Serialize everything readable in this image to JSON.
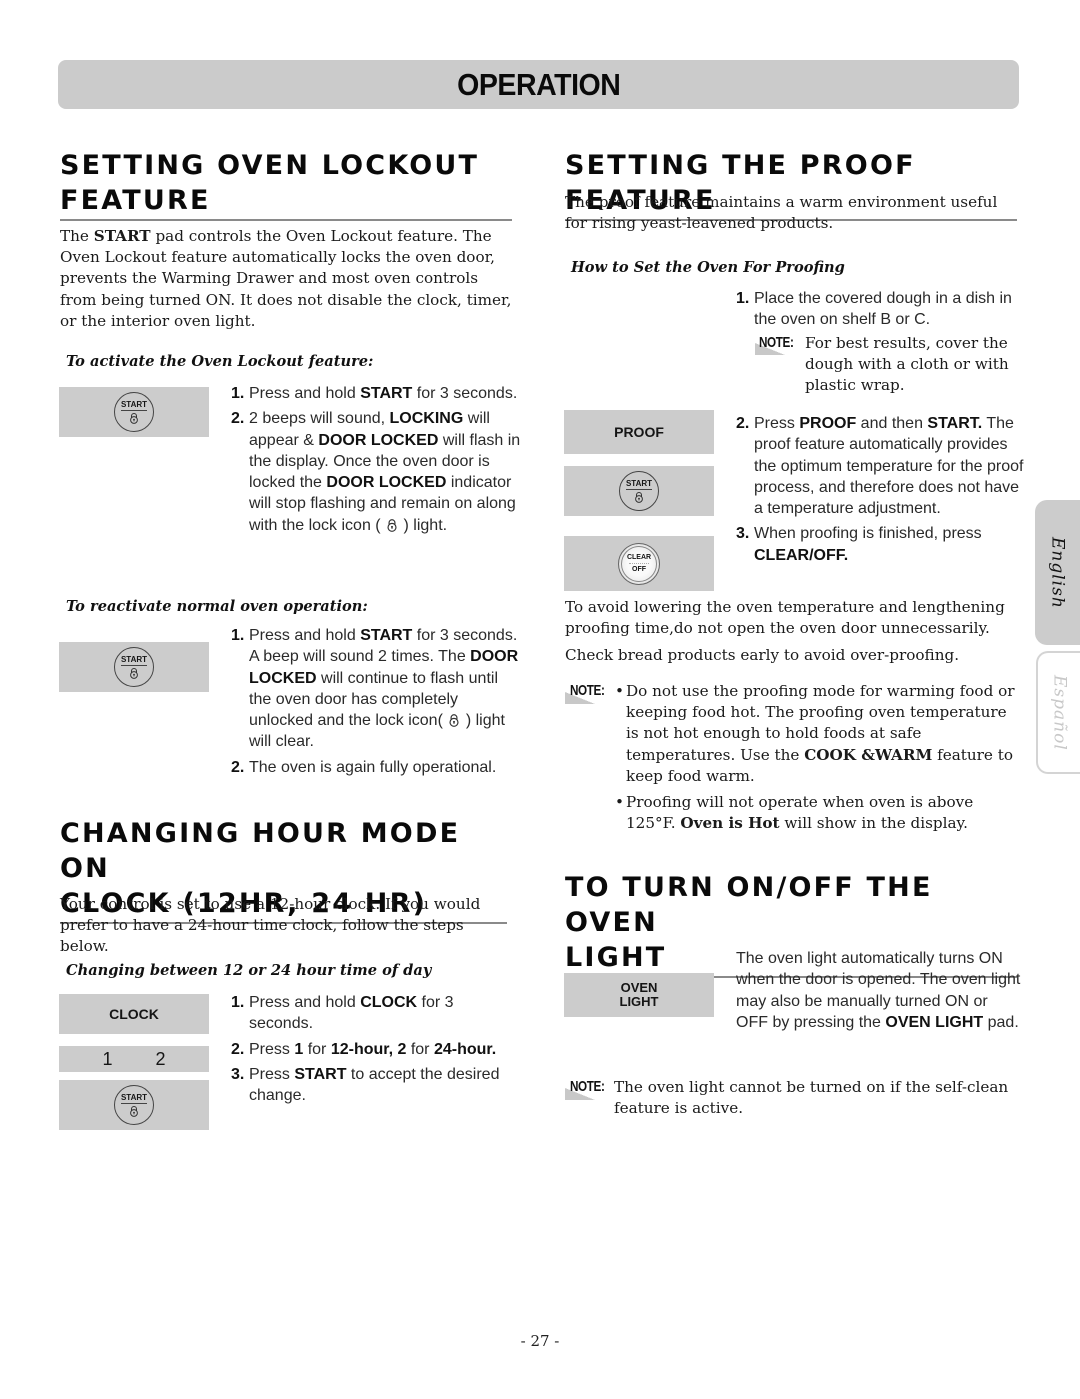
{
  "header": {
    "title": "OPERATION"
  },
  "lockout": {
    "title_line1": "SETTING OVEN LOCKOUT",
    "title_line2": "FEATURE",
    "intro_pre": "The ",
    "intro_bold": "START",
    "intro_post": " pad controls the Oven Lockout feature. The Oven Lockout feature automatically locks the oven door, prevents the Warming Drawer and most oven controls from being turned ON. It does not disable the clock, timer, or the interior oven light.",
    "activate_heading": "To activate the Oven Lockout feature:",
    "activate_pad": "START",
    "activate_steps": [
      {
        "num": "1.",
        "a": "Press and hold ",
        "b": "START",
        "c": " for 3 seconds."
      },
      {
        "num": "2.",
        "a": "2 beeps will sound, ",
        "b": "LOCKING",
        "c": " will appear & ",
        "d": "DOOR LOCKED",
        "e": " will flash in the display. Once the oven door is locked the ",
        "f": "DOOR LOCKED",
        "g": " indicator will stop flashing and remain on along with the lock icon (",
        "h": ") light."
      }
    ],
    "reactivate_heading": "To reactivate normal oven operation:",
    "reactivate_pad": "START",
    "reactivate_steps": [
      {
        "num": "1.",
        "a": "Press and hold ",
        "b": "START",
        "c": " for 3 seconds. A beep will sound 2 times. The ",
        "d": "DOOR LOCKED",
        "e": " will continue to flash until the oven door has completely unlocked and the lock icon(",
        "f": ") light will clear."
      },
      {
        "num": "2.",
        "a": "The oven is again fully operational."
      }
    ]
  },
  "hour_mode": {
    "title_line1": "CHANGING HOUR MODE ON",
    "title_line2": "CLOCK (12HR, 24 HR)",
    "intro": "Your control is set to use a 12-hour clock. If you would prefer to have a 24-hour time clock, follow the steps below.",
    "sub_heading": "Changing between 12 or 24 hour time of day",
    "pads": {
      "clock": "CLOCK",
      "key1": "1",
      "key2": "2",
      "start": "START"
    },
    "steps": [
      {
        "num": "1.",
        "a": "Press and hold ",
        "b": "CLOCK",
        "c": " for 3 seconds."
      },
      {
        "num": "2.",
        "a": "Press ",
        "b": "1",
        "c": " for ",
        "d": "12-hour, 2",
        "e": " for ",
        "f": "24-hour."
      },
      {
        "num": "3.",
        "a": "Press ",
        "b": "START",
        "c": " to accept the desired change."
      }
    ]
  },
  "proof": {
    "title": "SETTING THE PROOF FEATURE",
    "intro": "The proof feature maintains a warm environment useful for rising yeast-leavened products.",
    "sub_heading": "How to Set the Oven For Proofing",
    "step1": {
      "num": "1.",
      "text": "Place the covered dough in a dish in the oven on shelf B or C."
    },
    "note_label": "NOTE:",
    "step1_note": "For best results, cover the dough with a cloth or with plastic wrap.",
    "pads": {
      "proof": "PROOF",
      "start": "START",
      "clear_top": "CLEAR",
      "clear_bottom": "OFF"
    },
    "step2": {
      "num": "2.",
      "a": "Press ",
      "b": "PROOF",
      "c": " and then ",
      "d": "START.",
      "e": " The proof feature automatically provides the optimum temperature for the proof process, and therefore does not have a temperature adjustment."
    },
    "step3": {
      "num": "3.",
      "a": "When proofing is finished, press ",
      "b": "CLEAR/OFF."
    },
    "para1": "To avoid lowering the oven temperature and lengthening proofing time,do not open the oven door unnecessarily.",
    "para2": "Check bread products early to avoid over-proofing.",
    "notes": [
      {
        "a": "Do not use the proofing mode for warming food or keeping food hot. The proofing oven temperature is not hot enough to hold foods at safe temperatures. Use the ",
        "b": "COOK &WARM",
        "c": " feature to keep food warm."
      },
      {
        "a": "Proofing will not operate when oven is above 125°F. ",
        "b": "Oven is Hot",
        "c": " will show in the display."
      }
    ]
  },
  "oven_light": {
    "title_line1": "TO TURN ON/OFF THE OVEN",
    "title_line2": "LIGHT",
    "pad_line1": "OVEN",
    "pad_line2": "LIGHT",
    "text_a": "The oven light automatically turns ON when the door is opened. The oven light may also be manually turned ON or OFF by pressing the ",
    "text_b": "OVEN LIGHT",
    "text_c": " pad.",
    "note_label": "NOTE:",
    "note": "The oven light cannot be turned on if the self-clean feature is active."
  },
  "language_tabs": [
    {
      "label": "English",
      "active": true
    },
    {
      "label": "Español",
      "active": false
    }
  ],
  "footer": {
    "page_number": "- 27 -"
  }
}
